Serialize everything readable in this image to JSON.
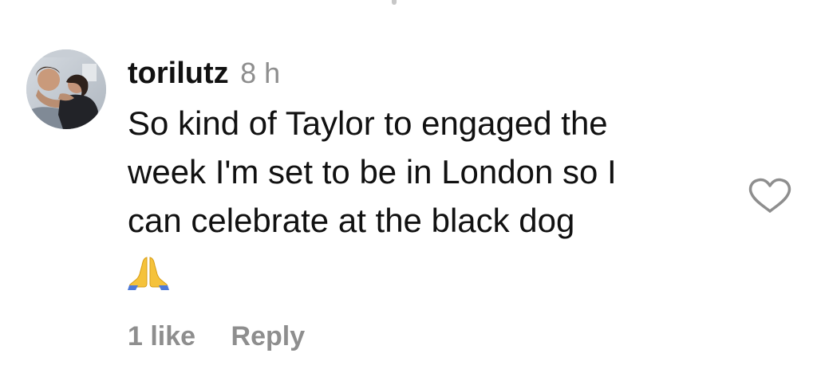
{
  "comment": {
    "username": "torilutz",
    "timestamp": "8 h",
    "lines": [
      "So kind of Taylor to engaged the",
      "week I'm set to be in London so I",
      "can celebrate at the black dog"
    ],
    "emoji": "praying-hands-emoji",
    "avatar_icon": "avatar-photo-icon",
    "like_icon": "heart-outline-icon"
  },
  "footer": {
    "likes": "1 like",
    "reply": "Reply"
  },
  "colors": {
    "text": "#111111",
    "meta": "#8e8e8e",
    "background": "#ffffff",
    "heart_stroke": "#8e8e8e"
  }
}
